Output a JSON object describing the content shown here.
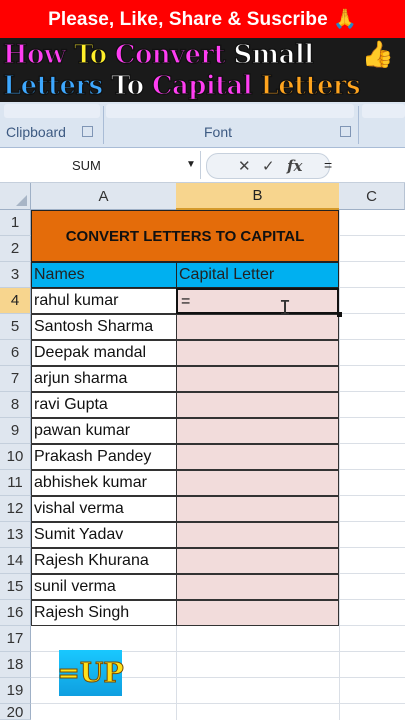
{
  "overlay": {
    "top_banner": "Please, Like, Share & Suscribe 🙏",
    "title_line1": [
      {
        "text": "How ",
        "color": "magenta"
      },
      {
        "text": "To ",
        "color": "yellow"
      },
      {
        "text": "Convert ",
        "color": "magenta"
      },
      {
        "text": "Small",
        "color": "white"
      }
    ],
    "title_line2": [
      {
        "text": "Letters ",
        "color": "blue"
      },
      {
        "text": "To ",
        "color": "white"
      },
      {
        "text": "Capital ",
        "color": "magenta"
      },
      {
        "text": "Letters",
        "color": "orange"
      }
    ],
    "thumb_emoji": "👍",
    "badge_text": "=UP"
  },
  "ribbon": {
    "clipboard_label": "Clipboard",
    "font_label": "Font"
  },
  "formula_bar": {
    "name_box": "SUM",
    "cancel_symbol": "✕",
    "enter_symbol": "✓",
    "fx_label": "fx",
    "value": "="
  },
  "columns": [
    "A",
    "B",
    "C"
  ],
  "rows": [
    "1",
    "2",
    "3",
    "4",
    "5",
    "6",
    "7",
    "8",
    "9",
    "10",
    "11",
    "12",
    "13",
    "14",
    "15",
    "16",
    "17",
    "18",
    "19",
    "20"
  ],
  "sheet": {
    "title": "CONVERT LETTERS TO CAPITAL",
    "header_names": "Names",
    "header_capital": "Capital Letter",
    "active_cell_value": "=",
    "names": [
      "rahul kumar",
      "Santosh Sharma",
      "Deepak mandal",
      "arjun sharma",
      "ravi  Gupta",
      "pawan  kumar",
      "Prakash Pandey",
      "abhishek  kumar",
      "vishal verma",
      "Sumit Yadav",
      "Rajesh Khurana",
      "sunil verma",
      "Rajesh Singh"
    ]
  },
  "colors": {
    "title_band": "#e46c0a",
    "header_band": "#00b0f0",
    "capital_cells": "#f2dcdb",
    "top_banner": "#ff0000"
  }
}
